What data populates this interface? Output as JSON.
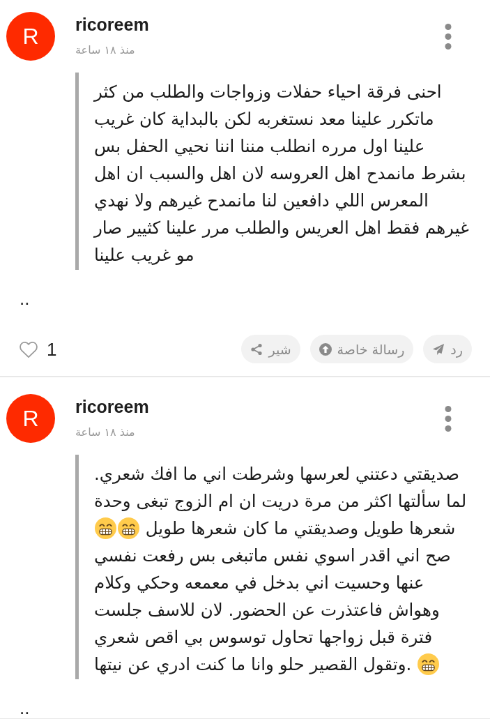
{
  "posts": [
    {
      "avatar_letter": "R",
      "username": "ricoreem",
      "timestamp": "منذ ١٨ ساعة",
      "body": [
        [
          {
            "kind": "text",
            "text": "احنى فرقة احياء حفلات وزواجات والطلب من كثر"
          }
        ],
        [
          {
            "kind": "text",
            "text": "ماتكرر علينا معد نستغربه لكن بالبداية كان غريب"
          }
        ],
        [
          {
            "kind": "text",
            "text": "علينا اول مرره انطلب مننا اننا نحيي الحفل بس"
          }
        ],
        [
          {
            "kind": "text",
            "text": "بشرط مانمدح اهل العروسه لان اهل والسبب ان اهل"
          }
        ],
        [
          {
            "kind": "text",
            "text": "المعرس اللي دافعين لنا مانمدح غيرهم ولا نهدي"
          }
        ],
        [
          {
            "kind": "text",
            "text": "غيرهم فقط اهل العريس والطلب مرر علينا كثيير صار"
          }
        ],
        [
          {
            "kind": "text",
            "text": "مو غريب علينا"
          }
        ]
      ],
      "footer_text": "..",
      "likes": {
        "count": "1",
        "liked": false
      },
      "actions": [
        {
          "kind": "reply",
          "label": "رد"
        },
        {
          "kind": "private_message",
          "label": "رسالة خاصة"
        },
        {
          "kind": "share",
          "label": "شير"
        }
      ]
    },
    {
      "avatar_letter": "R",
      "username": "ricoreem",
      "timestamp": "منذ ١٨ ساعة",
      "body": [
        [
          {
            "kind": "text",
            "text": "صديقتي دعتني لعرسها وشرطت اني ما افك شعري."
          }
        ],
        [
          {
            "kind": "text",
            "text": "لما سألتها اكثر من مرة دريت ان ام الزوج تبغى وحدة"
          }
        ],
        [
          {
            "kind": "text",
            "text": "شعرها طويل وصديقتي ما كان شعرها طويل"
          },
          {
            "kind": "emoji"
          },
          {
            "kind": "emoji"
          }
        ],
        [
          {
            "kind": "text",
            "text": "صح اني اقدر اسوي نفس ماتبغى بس رفعت نفسي"
          }
        ],
        [
          {
            "kind": "text",
            "text": "عنها وحسيت اني بدخل في معمعه وحكي وكلام"
          }
        ],
        [
          {
            "kind": "text",
            "text": "وهواش فاعتذرت عن الحضور. لان للاسف جلست"
          }
        ],
        [
          {
            "kind": "text",
            "text": "فترة قبل زواجها تحاول توسوس بي اقص شعري"
          }
        ],
        [
          {
            "kind": "emoji"
          },
          {
            "kind": "text",
            "text": ".وتقول القصير حلو وانا ما كنت ادري عن نيتها"
          }
        ]
      ],
      "footer_text": ".."
    }
  ]
}
